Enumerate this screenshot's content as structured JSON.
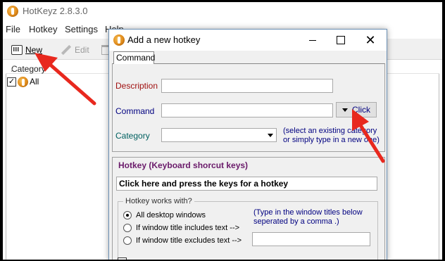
{
  "app": {
    "title": "HotKeyz 2.8.3.0",
    "menu": [
      "File",
      "Hotkey",
      "Settings",
      "Help"
    ],
    "toolbar": {
      "new_label": "New",
      "edit_label": "Edit"
    },
    "category_header": "Category",
    "sort_indicator": "/",
    "tree": [
      {
        "label": "All",
        "checked": true
      }
    ]
  },
  "dialog": {
    "title": "Add a new hotkey",
    "tab_label": "Command",
    "description_label": "Description",
    "description_value": "",
    "command_label": "Command",
    "command_value": "",
    "click_button_label": "Click",
    "category_label": "Category",
    "category_value": "",
    "category_hint": "(select an existing category or simply type in a new one)",
    "hotkey_group_title": "Hotkey (Keyboard shorcut keys)",
    "hotkey_field_text": "Click here and press the keys for a hotkey",
    "works_with_title": "Hotkey works with?",
    "options": [
      {
        "label": "All desktop windows",
        "selected": true
      },
      {
        "label": "If window title includes text -->",
        "selected": false
      },
      {
        "label": "If window title excludes text -->",
        "selected": false
      }
    ],
    "window_titles_hint": "(Type in the window titles below seperated by a comma .)",
    "window_titles_value": ""
  },
  "colors": {
    "description_label": "#a01010",
    "command_label": "#000080",
    "category_label": "#006060",
    "hotkey_title": "#6a1a6a",
    "annotation_arrow": "#e8281e"
  },
  "icons": [
    "app-icon",
    "keyboard-icon",
    "pencil-icon",
    "trash-icon",
    "checkbox-icon",
    "dropdown-arrow-icon",
    "close-icon",
    "maximize-icon",
    "minimize-icon",
    "red-arrow-annotation"
  ]
}
